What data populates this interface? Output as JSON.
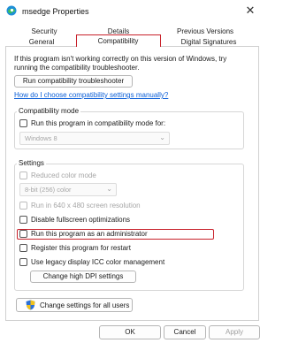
{
  "window": {
    "title": "msedge Properties",
    "close_symbol": "✕"
  },
  "tabs": {
    "row1": [
      "Security",
      "Details",
      "Previous Versions"
    ],
    "row2": [
      "General",
      "Compatibility",
      "Digital Signatures"
    ],
    "active": "Compatibility"
  },
  "intro_text": "If this program isn't working correctly on this version of Windows, try running the compatibility troubleshooter.",
  "troubleshooter_button": "Run compatibility troubleshooter",
  "manual_link": "How do I choose compatibility settings manually?",
  "compat_mode": {
    "title": "Compatibility mode",
    "checkbox_label": "Run this program in compatibility mode for:",
    "checked": false,
    "dropdown_value": "Windows 8",
    "dropdown_enabled": false
  },
  "settings": {
    "title": "Settings",
    "reduced_color": {
      "label": "Reduced color mode",
      "checked": false,
      "enabled": false
    },
    "color_dropdown": "8-bit (256) color",
    "run_640": {
      "label": "Run in 640 x 480 screen resolution",
      "checked": false,
      "enabled": false
    },
    "disable_fullscreen": {
      "label": "Disable fullscreen optimizations",
      "checked": false
    },
    "run_admin": {
      "label": "Run this program as an administrator",
      "checked": false,
      "highlighted": true
    },
    "register_restart": {
      "label": "Register this program for restart",
      "checked": false
    },
    "legacy_icc": {
      "label": "Use legacy display ICC color management",
      "checked": false
    },
    "dpi_button": "Change high DPI settings"
  },
  "all_users_button": "Change settings for all users",
  "buttons": {
    "ok": "OK",
    "cancel": "Cancel",
    "apply": "Apply"
  },
  "colors": {
    "highlight": "#c8212b",
    "link": "#0a5ed7",
    "shield_blue": "#2b6fd6",
    "shield_yellow": "#f2c21b"
  }
}
